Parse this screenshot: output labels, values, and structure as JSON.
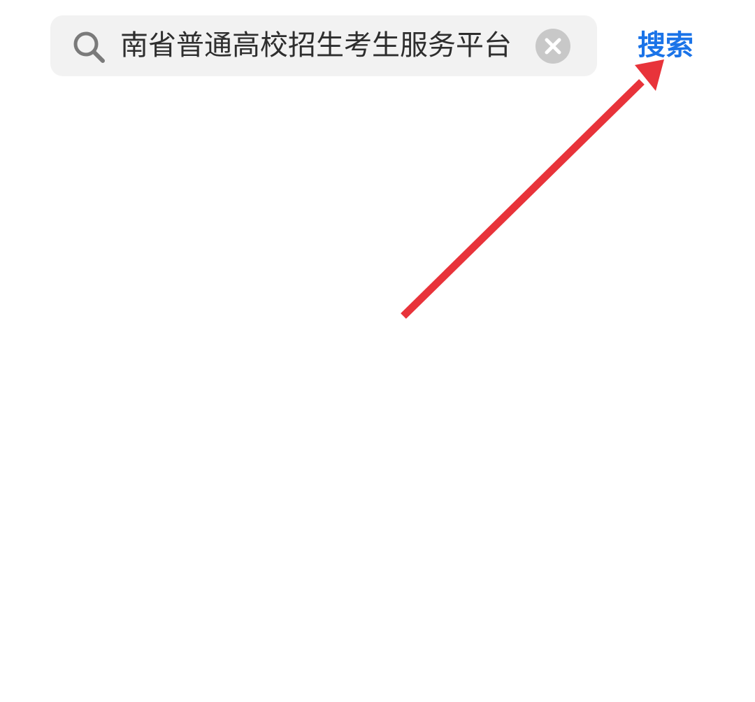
{
  "search": {
    "query": "南省普通高校招生考生服务平台",
    "search_label": "搜索"
  },
  "icons": {
    "search": "search-icon",
    "clear": "close-circle-icon",
    "annotation": "arrow-icon"
  },
  "colors": {
    "search_box_bg": "#f2f2f2",
    "search_button": "#1a73e8",
    "clear_button_bg": "#c8c8c8",
    "annotation_arrow": "#e8333a"
  }
}
